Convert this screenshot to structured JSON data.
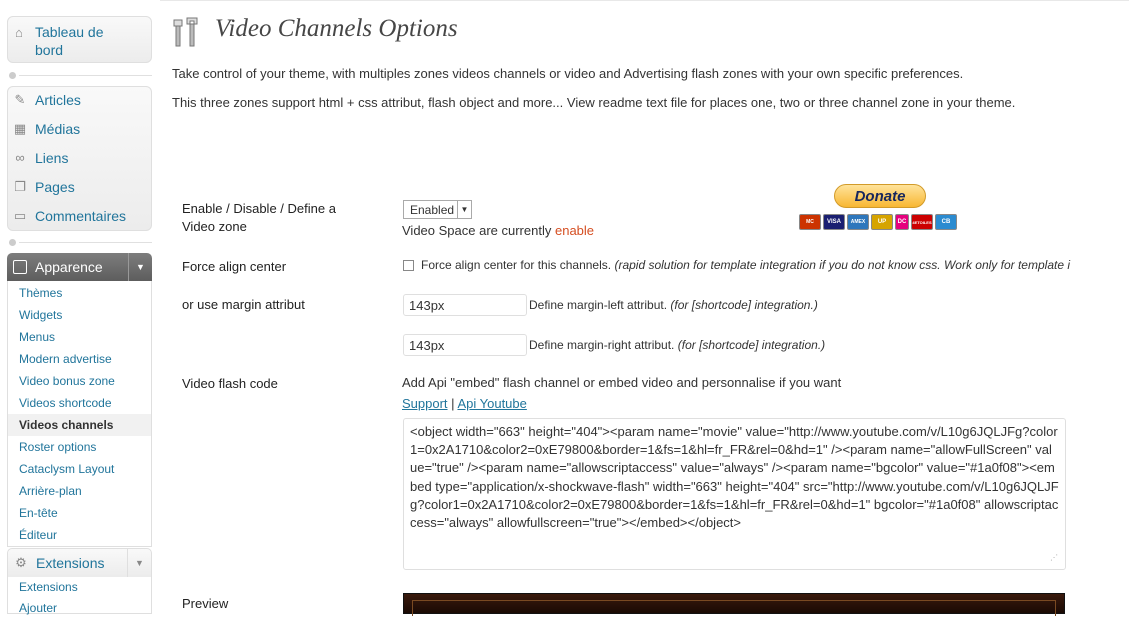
{
  "sidebar": {
    "dashboard": "Tableau de bord",
    "items": [
      {
        "label": "Articles",
        "icon": "pin-icon"
      },
      {
        "label": "Médias",
        "icon": "media-icon"
      },
      {
        "label": "Liens",
        "icon": "link-icon"
      },
      {
        "label": "Pages",
        "icon": "pages-icon"
      },
      {
        "label": "Commentaires",
        "icon": "comment-icon"
      }
    ],
    "appearance": {
      "label": "Apparence",
      "submenu": [
        "Thèmes",
        "Widgets",
        "Menus",
        "Modern advertise",
        "Video bonus zone",
        "Videos shortcode",
        "Videos channels",
        "Roster options",
        "Cataclysm Layout",
        "Arrière-plan",
        "En-tête",
        "Éditeur"
      ],
      "current": "Videos channels"
    },
    "extensions": {
      "label": "Extensions",
      "submenu": [
        "Extensions",
        "Ajouter"
      ]
    }
  },
  "main": {
    "title": "Video Channels Options",
    "desc1": "Take control of your theme, with multiples zones videos channels or video and Advertising flash zones with your own specific preferences.",
    "desc2": "This three zones support html + css attribut, flash object and more... View readme text file for places one, two or three channel zone in your theme.",
    "enable": {
      "label": "Enable / Disable / Define a Video zone",
      "select_value": "Enabled",
      "status_prefix": "Video Space are currently",
      "status_value": "enable"
    },
    "donate": {
      "label": "Donate",
      "cards": [
        {
          "name": "MC",
          "color": "#cc3300"
        },
        {
          "name": "VISA",
          "color": "#1a1f71"
        },
        {
          "name": "AMEX",
          "color": "#2e77bc"
        },
        {
          "name": "UP",
          "color": "#d6a400"
        },
        {
          "name": "DC",
          "color": "#e6007e"
        },
        {
          "name": "4ETOILES",
          "color": "#cc0000"
        },
        {
          "name": "CB",
          "color": "#2b8bd0"
        }
      ]
    },
    "force_align": {
      "label": "Force align center",
      "text": "Force align center for this channels.",
      "note": "(rapid solution for template integration if you do not know css. Work only for template i"
    },
    "margin": {
      "label": "or use margin attribut",
      "left_value": "143px",
      "left_text": "Define margin-left attribut.",
      "left_note": "(for [shortcode] integration.)",
      "right_value": "143px",
      "right_text": "Define margin-right attribut.",
      "right_note": "(for [shortcode] integration.)"
    },
    "flash": {
      "label": "Video flash code",
      "intro": "Add Api \"embed\" flash channel or embed video and personnalise if you want",
      "support_link": "Support",
      "separator": "|",
      "api_link": "Api Youtube",
      "code": "<object width=\"663\" height=\"404\"><param name=\"movie\" value=\"http://www.youtube.com/v/L10g6JQLJFg?color1=0x2A1710&color2=0xE79800&border=1&fs=1&hl=fr_FR&rel=0&hd=1\" /><param name=\"allowFullScreen\" value=\"true\" /><param name=\"allowscriptaccess\" value=\"always\" /><param name=\"bgcolor\" value=\"#1a0f08\"><embed type=\"application/x-shockwave-flash\" width=\"663\" height=\"404\" src=\"http://www.youtube.com/v/L10g6JQLJFg?color1=0x2A1710&color2=0xE79800&border=1&fs=1&hl=fr_FR&rel=0&hd=1\" bgcolor=\"#1a0f08\" allowscriptaccess=\"always\" allowfullscreen=\"true\"></embed></object>"
    },
    "preview": {
      "label": "Preview"
    }
  },
  "colors": {
    "link": "#21759b",
    "status_enable": "#d54e21"
  }
}
